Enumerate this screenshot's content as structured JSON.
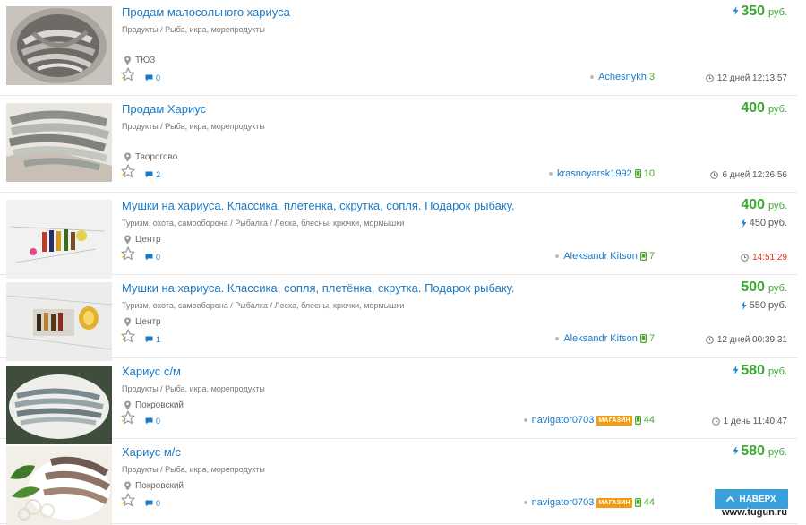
{
  "listings": [
    {
      "title": "Продам малосольного хариуса",
      "category": "Продукты / Рыба, икра, морепродукты",
      "location": "ТЮЗ",
      "comments": "0",
      "seller": "Achesnykh",
      "phone": false,
      "shop": false,
      "rating": "3",
      "date": "12 дней 12:13:57",
      "date_today": false,
      "price": "350",
      "price_bolt": true,
      "currency": "руб.",
      "price_alt": null
    },
    {
      "title": "Продам Хариус",
      "category": "Продукты / Рыба, икра, морепродукты",
      "location": "Творогово",
      "comments": "2",
      "seller": "krasnoyarsk1992",
      "phone": true,
      "shop": false,
      "rating": "10",
      "date": "6 дней 12:26:56",
      "date_today": false,
      "price": "400",
      "price_bolt": false,
      "currency": "руб.",
      "price_alt": null
    },
    {
      "title": "Мушки на хариуса. Классика, плетёнка, скрутка, сопля. Подарок рыбаку.",
      "category": "Туризм, охота, самооборона / Рыбалка / Леска, блесны, крючки, мормышки",
      "location": "Центр",
      "comments": "0",
      "seller": "Aleksandr Kitson",
      "phone": true,
      "shop": false,
      "rating": "7",
      "date": "14:51:29",
      "date_today": true,
      "price": "400",
      "price_bolt": false,
      "currency": "руб.",
      "price_alt": "450 руб."
    },
    {
      "title": "Мушки на хариуса. Классика, сопля, плетёнка, скрутка. Подарок рыбаку.",
      "category": "Туризм, охота, самооборона / Рыбалка / Леска, блесны, крючки, мормышки",
      "location": "Центр",
      "comments": "1",
      "seller": "Aleksandr Kitson",
      "phone": true,
      "shop": false,
      "rating": "7",
      "date": "12 дней 00:39:31",
      "date_today": false,
      "price": "500",
      "price_bolt": false,
      "currency": "руб.",
      "price_alt": "550 руб."
    },
    {
      "title": "Хариус с/м",
      "category": "Продукты / Рыба, икра, морепродукты",
      "location": "Покровский",
      "comments": "0",
      "seller": "navigator0703",
      "phone": true,
      "shop": true,
      "rating": "44",
      "date": "1 день 11:40:47",
      "date_today": false,
      "price": "580",
      "price_bolt": true,
      "currency": "руб.",
      "price_alt": null
    },
    {
      "title": "Хариус м/с",
      "category": "Продукты / Рыба, икра, морепродукты",
      "location": "Покровский",
      "comments": "0",
      "seller": "navigator0703",
      "phone": true,
      "shop": true,
      "rating": "44",
      "date": "",
      "date_today": false,
      "price": "580",
      "price_bolt": true,
      "currency": "руб.",
      "price_alt": null
    }
  ],
  "shop_badge_label": "МАГАЗИН",
  "to_top_label": "НАВЕРХ",
  "watermark": "www.tugun.ru",
  "colors": {
    "link": "#1a7ac6",
    "price": "#3aa833",
    "rating": "#4aa82e",
    "today": "#e0301e",
    "shop_badge": "#f39c12",
    "to_top": "#39a0dc"
  }
}
